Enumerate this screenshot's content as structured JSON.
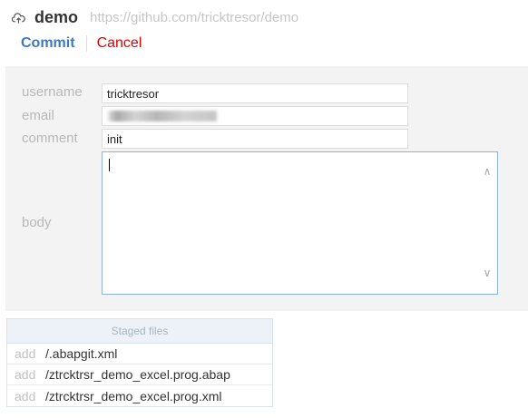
{
  "header": {
    "repo_name": "demo",
    "repo_url": "https://github.com/tricktresor/demo",
    "commit_label": "Commit",
    "cancel_label": "Cancel"
  },
  "form": {
    "username_label": "username",
    "username_value": "tricktresor",
    "email_label": "email",
    "email_value": "",
    "comment_label": "comment",
    "comment_value": "init",
    "body_label": "body",
    "body_value": ""
  },
  "staged": {
    "title": "Staged files",
    "files": [
      {
        "status": "add",
        "name": "/.abapgit.xml"
      },
      {
        "status": "add",
        "name": "/ztrcktrsr_demo_excel.prog.abap"
      },
      {
        "status": "add",
        "name": "/ztrcktrsr_demo_excel.prog.xml"
      }
    ]
  },
  "colors": {
    "link": "#4078c0",
    "cancel": "#e00000",
    "panel_bg": "#f3f3f3",
    "staged_header_bg": "#edf2f9"
  },
  "icons": {
    "repo_icon": "cloud-upload-icon",
    "scroll_up": "chevron-up-icon",
    "scroll_down": "chevron-down-icon"
  }
}
